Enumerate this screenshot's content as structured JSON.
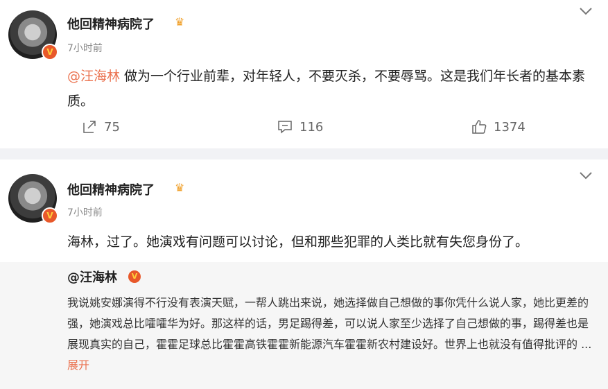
{
  "posts": [
    {
      "username": "他回精神病院了",
      "time": "7小时前",
      "mention": "@汪海林",
      "text": " 做为一个行业前辈，对年轻人，不要灭杀，不要辱骂。这是我们年长者的基本素质。",
      "actions": {
        "repost": "75",
        "comment": "116",
        "like": "1374"
      }
    },
    {
      "username": "他回精神病院了",
      "time": "7小时前",
      "text": "海林，过了。她演戏有问题可以讨论，但和那些犯罪的人类比就有失您身份了。",
      "quote": {
        "author": "@汪海林",
        "text": "我说姚安娜演得不行没有表演天赋，一帮人跳出来说，她选择做自己想做的事你凭什么说人家，她比更差的强，她演戏总比嚯嚯华为好。那这样的话，男足踢得差，可以说人家至少选择了自己想做的事，踢得差也是展现真实的自己，霍霍足球总比霍霍高铁霍霍新能源汽车霍霍新农村建设好。世界上也就没有值得批评的 ",
        "ellipsis": "... ",
        "expand": "展开"
      }
    }
  ],
  "icons": {
    "verified": "verified-badge-icon",
    "crown": "crown-icon",
    "more": "chevron-down-icon",
    "repost": "repost-icon",
    "comment": "comment-icon",
    "like": "like-icon"
  },
  "colors": {
    "accent": "#eb7350",
    "badge": "#e8582a",
    "muted": "#8a8a8a"
  }
}
